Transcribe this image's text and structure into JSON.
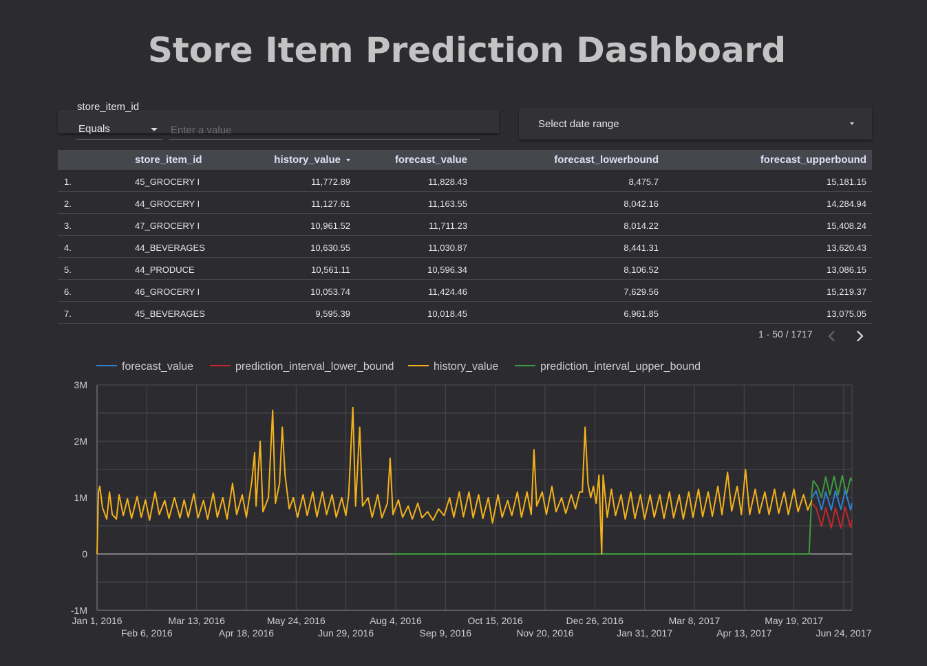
{
  "dashboard": {
    "title": "Store Item Prediction Dashboard"
  },
  "filter": {
    "label": "store_item_id",
    "operator": "Equals",
    "placeholder": "Enter a value"
  },
  "date_range": {
    "label": "Select date range"
  },
  "table": {
    "columns": [
      "store_item_id",
      "history_value",
      "forecast_value",
      "forecast_lowerbound",
      "forecast_upperbound"
    ],
    "sorted_column": "history_value",
    "rows": [
      {
        "rank": "1.",
        "store_item_id": "45_GROCERY I",
        "history_value": "11,772.89",
        "forecast_value": "11,828.43",
        "forecast_lowerbound": "8,475.7",
        "forecast_upperbound": "15,181.15"
      },
      {
        "rank": "2.",
        "store_item_id": "44_GROCERY I",
        "history_value": "11,127.61",
        "forecast_value": "11,163.55",
        "forecast_lowerbound": "8,042.16",
        "forecast_upperbound": "14,284.94"
      },
      {
        "rank": "3.",
        "store_item_id": "47_GROCERY I",
        "history_value": "10,961.52",
        "forecast_value": "11,711.23",
        "forecast_lowerbound": "8,014.22",
        "forecast_upperbound": "15,408.24"
      },
      {
        "rank": "4.",
        "store_item_id": "44_BEVERAGES",
        "history_value": "10,630.55",
        "forecast_value": "11,030.87",
        "forecast_lowerbound": "8,441.31",
        "forecast_upperbound": "13,620.43"
      },
      {
        "rank": "5.",
        "store_item_id": "44_PRODUCE",
        "history_value": "10,561.11",
        "forecast_value": "10,596.34",
        "forecast_lowerbound": "8,106.52",
        "forecast_upperbound": "13,086.15"
      },
      {
        "rank": "6.",
        "store_item_id": "46_GROCERY I",
        "history_value": "10,053.74",
        "forecast_value": "11,424.46",
        "forecast_lowerbound": "7,629.56",
        "forecast_upperbound": "15,219.37"
      },
      {
        "rank": "7.",
        "store_item_id": "45_BEVERAGES",
        "history_value": "9,595.39",
        "forecast_value": "10,018.45",
        "forecast_lowerbound": "6,961.85",
        "forecast_upperbound": "13,075.05"
      }
    ]
  },
  "pagination": {
    "text": "1 - 50 / 1717"
  },
  "icons": {
    "prev": "chevron-left-icon",
    "next": "chevron-right-icon",
    "dropdown": "caret-down-icon"
  },
  "chart_data": {
    "type": "line",
    "x_type": "date",
    "xlim": [
      "2016-01-01",
      "2017-06-30"
    ],
    "ylim": [
      -1000000,
      3000000
    ],
    "y_ticks": [
      "-1M",
      "0",
      "1M",
      "2M",
      "3M"
    ],
    "y_tick_values": [
      -1000000,
      0,
      1000000,
      2000000,
      3000000
    ],
    "x_ticks": [
      {
        "date": "2016-01-01",
        "label": "Jan 1, 2016"
      },
      {
        "date": "2016-02-06",
        "label": "Feb 6, 2016"
      },
      {
        "date": "2016-03-13",
        "label": "Mar 13, 2016"
      },
      {
        "date": "2016-04-18",
        "label": "Apr 18, 2016"
      },
      {
        "date": "2016-05-24",
        "label": "May 24, 2016"
      },
      {
        "date": "2016-06-29",
        "label": "Jun 29, 2016"
      },
      {
        "date": "2016-08-04",
        "label": "Aug 4, 2016"
      },
      {
        "date": "2016-09-09",
        "label": "Sep 9, 2016"
      },
      {
        "date": "2016-10-15",
        "label": "Oct 15, 2016"
      },
      {
        "date": "2016-11-20",
        "label": "Nov 20, 2016"
      },
      {
        "date": "2016-12-26",
        "label": "Dec 26, 2016"
      },
      {
        "date": "2017-01-31",
        "label": "Jan 31, 2017"
      },
      {
        "date": "2017-03-08",
        "label": "Mar 8, 2017"
      },
      {
        "date": "2017-04-13",
        "label": "Apr 13, 2017"
      },
      {
        "date": "2017-05-19",
        "label": "May 19, 2017"
      },
      {
        "date": "2017-06-24",
        "label": "Jun 24, 2017"
      }
    ],
    "grid": true,
    "legend_position": "top-left",
    "series": [
      {
        "name": "forecast_value",
        "color": "#2f7fd4",
        "points": [
          [
            "2017-06-01",
            1000000
          ],
          [
            "2017-06-04",
            1120000
          ],
          [
            "2017-06-08",
            780000
          ],
          [
            "2017-06-11",
            1100000
          ],
          [
            "2017-06-15",
            780000
          ],
          [
            "2017-06-18",
            1120000
          ],
          [
            "2017-06-22",
            790000
          ],
          [
            "2017-06-25",
            1130000
          ],
          [
            "2017-06-29",
            780000
          ],
          [
            "2017-06-30",
            900000
          ]
        ]
      },
      {
        "name": "prediction_interval_lower_bound",
        "color": "#c1272d",
        "points": [
          [
            "2017-06-01",
            900000
          ],
          [
            "2017-06-04",
            820000
          ],
          [
            "2017-06-08",
            490000
          ],
          [
            "2017-06-11",
            820000
          ],
          [
            "2017-06-15",
            460000
          ],
          [
            "2017-06-18",
            820000
          ],
          [
            "2017-06-22",
            460000
          ],
          [
            "2017-06-25",
            830000
          ],
          [
            "2017-06-29",
            470000
          ],
          [
            "2017-06-30",
            600000
          ]
        ]
      },
      {
        "name": "history_value",
        "color": "#f3b11c",
        "points": [
          [
            "2016-01-01",
            0
          ],
          [
            "2016-01-02",
            1100000
          ],
          [
            "2016-01-03",
            1200000
          ],
          [
            "2016-01-05",
            820000
          ],
          [
            "2016-01-08",
            620000
          ],
          [
            "2016-01-10",
            1100000
          ],
          [
            "2016-01-12",
            700000
          ],
          [
            "2016-01-15",
            620000
          ],
          [
            "2016-01-17",
            1050000
          ],
          [
            "2016-01-20",
            680000
          ],
          [
            "2016-01-23",
            980000
          ],
          [
            "2016-01-26",
            630000
          ],
          [
            "2016-01-30",
            1020000
          ],
          [
            "2016-02-02",
            650000
          ],
          [
            "2016-02-05",
            960000
          ],
          [
            "2016-02-08",
            600000
          ],
          [
            "2016-02-12",
            1100000
          ],
          [
            "2016-02-15",
            700000
          ],
          [
            "2016-02-19",
            950000
          ],
          [
            "2016-02-22",
            630000
          ],
          [
            "2016-02-26",
            1000000
          ],
          [
            "2016-03-01",
            640000
          ],
          [
            "2016-03-04",
            960000
          ],
          [
            "2016-03-07",
            650000
          ],
          [
            "2016-03-11",
            1070000
          ],
          [
            "2016-03-14",
            640000
          ],
          [
            "2016-03-18",
            950000
          ],
          [
            "2016-03-21",
            620000
          ],
          [
            "2016-03-25",
            1080000
          ],
          [
            "2016-03-28",
            650000
          ],
          [
            "2016-04-01",
            1000000
          ],
          [
            "2016-04-04",
            620000
          ],
          [
            "2016-04-08",
            1250000
          ],
          [
            "2016-04-11",
            700000
          ],
          [
            "2016-04-15",
            1050000
          ],
          [
            "2016-04-18",
            650000
          ],
          [
            "2016-04-22",
            1300000
          ],
          [
            "2016-04-24",
            1800000
          ],
          [
            "2016-04-25",
            850000
          ],
          [
            "2016-04-28",
            2000000
          ],
          [
            "2016-04-30",
            750000
          ],
          [
            "2016-05-04",
            1000000
          ],
          [
            "2016-05-07",
            2550000
          ],
          [
            "2016-05-09",
            900000
          ],
          [
            "2016-05-12",
            1250000
          ],
          [
            "2016-05-14",
            2250000
          ],
          [
            "2016-05-16",
            1400000
          ],
          [
            "2016-05-19",
            800000
          ],
          [
            "2016-05-22",
            1000000
          ],
          [
            "2016-05-25",
            650000
          ],
          [
            "2016-05-29",
            1050000
          ],
          [
            "2016-06-01",
            680000
          ],
          [
            "2016-06-05",
            1100000
          ],
          [
            "2016-06-08",
            660000
          ],
          [
            "2016-06-12",
            1100000
          ],
          [
            "2016-06-15",
            700000
          ],
          [
            "2016-06-19",
            1050000
          ],
          [
            "2016-06-22",
            650000
          ],
          [
            "2016-06-26",
            1000000
          ],
          [
            "2016-06-29",
            680000
          ],
          [
            "2016-07-01",
            1050000
          ],
          [
            "2016-07-04",
            2600000
          ],
          [
            "2016-07-06",
            850000
          ],
          [
            "2016-07-09",
            2250000
          ],
          [
            "2016-07-11",
            850000
          ],
          [
            "2016-07-15",
            1000000
          ],
          [
            "2016-07-18",
            650000
          ],
          [
            "2016-07-22",
            1050000
          ],
          [
            "2016-07-25",
            640000
          ],
          [
            "2016-07-29",
            900000
          ],
          [
            "2016-07-31",
            1700000
          ],
          [
            "2016-08-02",
            700000
          ],
          [
            "2016-08-06",
            960000
          ],
          [
            "2016-08-09",
            650000
          ],
          [
            "2016-08-13",
            850000
          ],
          [
            "2016-08-16",
            620000
          ],
          [
            "2016-08-20",
            900000
          ],
          [
            "2016-08-23",
            640000
          ],
          [
            "2016-08-27",
            750000
          ],
          [
            "2016-08-31",
            600000
          ],
          [
            "2016-09-04",
            800000
          ],
          [
            "2016-09-08",
            680000
          ],
          [
            "2016-09-12",
            1000000
          ],
          [
            "2016-09-15",
            650000
          ],
          [
            "2016-09-19",
            1100000
          ],
          [
            "2016-09-22",
            660000
          ],
          [
            "2016-09-26",
            1100000
          ],
          [
            "2016-09-29",
            640000
          ],
          [
            "2016-10-03",
            1050000
          ],
          [
            "2016-10-06",
            630000
          ],
          [
            "2016-10-10",
            1000000
          ],
          [
            "2016-10-13",
            550000
          ],
          [
            "2016-10-17",
            1050000
          ],
          [
            "2016-10-20",
            650000
          ],
          [
            "2016-10-24",
            950000
          ],
          [
            "2016-10-27",
            680000
          ],
          [
            "2016-10-31",
            1100000
          ],
          [
            "2016-11-03",
            650000
          ],
          [
            "2016-11-07",
            1100000
          ],
          [
            "2016-11-10",
            700000
          ],
          [
            "2016-11-12",
            1850000
          ],
          [
            "2016-11-14",
            850000
          ],
          [
            "2016-11-18",
            1100000
          ],
          [
            "2016-11-21",
            700000
          ],
          [
            "2016-11-25",
            1200000
          ],
          [
            "2016-11-28",
            750000
          ],
          [
            "2016-12-02",
            1000000
          ],
          [
            "2016-12-05",
            720000
          ],
          [
            "2016-12-09",
            1050000
          ],
          [
            "2016-12-12",
            800000
          ],
          [
            "2016-12-15",
            1100000
          ],
          [
            "2016-12-17",
            1100000
          ],
          [
            "2016-12-19",
            2250000
          ],
          [
            "2016-12-21",
            1250000
          ],
          [
            "2016-12-23",
            1000000
          ],
          [
            "2016-12-25",
            1200000
          ],
          [
            "2016-12-27",
            900000
          ],
          [
            "2016-12-29",
            1400000
          ],
          [
            "2016-12-31",
            0
          ],
          [
            "2017-01-01",
            1400000
          ],
          [
            "2017-01-04",
            650000
          ],
          [
            "2017-01-07",
            1150000
          ],
          [
            "2017-01-10",
            680000
          ],
          [
            "2017-01-14",
            1050000
          ],
          [
            "2017-01-17",
            620000
          ],
          [
            "2017-01-21",
            1100000
          ],
          [
            "2017-01-24",
            630000
          ],
          [
            "2017-01-28",
            1050000
          ],
          [
            "2017-01-31",
            620000
          ],
          [
            "2017-02-04",
            1050000
          ],
          [
            "2017-02-07",
            650000
          ],
          [
            "2017-02-11",
            1050000
          ],
          [
            "2017-02-14",
            630000
          ],
          [
            "2017-02-18",
            1100000
          ],
          [
            "2017-02-21",
            640000
          ],
          [
            "2017-02-25",
            1050000
          ],
          [
            "2017-02-28",
            620000
          ],
          [
            "2017-03-04",
            1100000
          ],
          [
            "2017-03-07",
            650000
          ],
          [
            "2017-03-11",
            1150000
          ],
          [
            "2017-03-14",
            660000
          ],
          [
            "2017-03-18",
            1100000
          ],
          [
            "2017-03-21",
            670000
          ],
          [
            "2017-03-25",
            1200000
          ],
          [
            "2017-03-28",
            700000
          ],
          [
            "2017-04-01",
            1450000
          ],
          [
            "2017-04-04",
            760000
          ],
          [
            "2017-04-08",
            1200000
          ],
          [
            "2017-04-11",
            700000
          ],
          [
            "2017-04-14",
            1500000
          ],
          [
            "2017-04-17",
            700000
          ],
          [
            "2017-04-21",
            1150000
          ],
          [
            "2017-04-24",
            720000
          ],
          [
            "2017-04-28",
            1100000
          ],
          [
            "2017-05-01",
            700000
          ],
          [
            "2017-05-05",
            1150000
          ],
          [
            "2017-05-08",
            720000
          ],
          [
            "2017-05-12",
            1100000
          ],
          [
            "2017-05-15",
            700000
          ],
          [
            "2017-05-19",
            1150000
          ],
          [
            "2017-05-22",
            750000
          ],
          [
            "2017-05-26",
            1050000
          ],
          [
            "2017-05-29",
            780000
          ],
          [
            "2017-06-01",
            950000
          ]
        ]
      },
      {
        "name": "prediction_interval_upper_bound",
        "color": "#3e9a3e",
        "points": [
          [
            "2016-08-01",
            0
          ],
          [
            "2017-05-30",
            0
          ],
          [
            "2017-06-01",
            1100000
          ],
          [
            "2017-06-02",
            1300000
          ],
          [
            "2017-06-05",
            1200000
          ],
          [
            "2017-06-08",
            1000000
          ],
          [
            "2017-06-11",
            1370000
          ],
          [
            "2017-06-14",
            1050000
          ],
          [
            "2017-06-17",
            1380000
          ],
          [
            "2017-06-20",
            1050000
          ],
          [
            "2017-06-23",
            1390000
          ],
          [
            "2017-06-26",
            1050000
          ],
          [
            "2017-06-29",
            1350000
          ],
          [
            "2017-06-30",
            1300000
          ]
        ]
      }
    ]
  }
}
